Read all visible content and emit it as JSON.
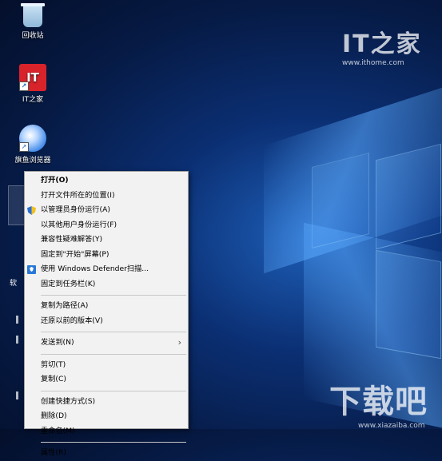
{
  "desktop": {
    "icons": [
      {
        "label": "回收站",
        "icon": "recycle-bin-icon"
      },
      {
        "label": "IT之家",
        "icon": "it-home-icon",
        "glyph": "IT"
      },
      {
        "label": "旗鱼浏览器",
        "icon": "browser-icon"
      }
    ],
    "partial_label": "软",
    "shortcut_glyph": "↗"
  },
  "watermarks": {
    "top_logo": "IT之家",
    "top_url": "www.ithome.com",
    "bottom_logo": "下载吧",
    "bottom_url": "www.xiazaiba.com"
  },
  "context_menu": {
    "groups": [
      [
        {
          "label": "打开(O)",
          "bold": true
        },
        {
          "label": "打开文件所在的位置(I)"
        },
        {
          "label": "以管理员身份运行(A)",
          "icon": "uac-shield-icon"
        },
        {
          "label": "以其他用户身份运行(F)"
        },
        {
          "label": "兼容性疑难解答(Y)"
        },
        {
          "label": "固定到\"开始\"屏幕(P)"
        },
        {
          "label": "使用 Windows Defender扫描...",
          "icon": "windows-defender-icon"
        },
        {
          "label": "固定到任务栏(K)"
        }
      ],
      [
        {
          "label": "复制为路径(A)"
        },
        {
          "label": "还原以前的版本(V)"
        }
      ],
      [
        {
          "label": "发送到(N)",
          "submenu": true
        }
      ],
      [
        {
          "label": "剪切(T)"
        },
        {
          "label": "复制(C)"
        }
      ],
      [
        {
          "label": "创建快捷方式(S)"
        },
        {
          "label": "删除(D)"
        },
        {
          "label": "重命名(M)"
        }
      ],
      [
        {
          "label": "属性(R)"
        }
      ]
    ],
    "submenu_arrow": "›"
  }
}
